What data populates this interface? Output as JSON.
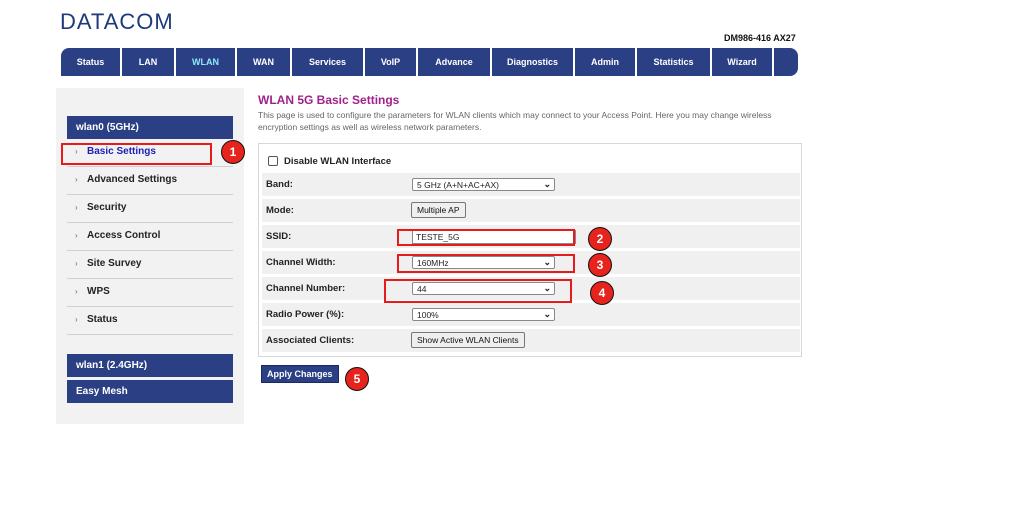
{
  "header": {
    "brand": "DATACOM",
    "model": "DM986-416 AX27"
  },
  "nav": [
    {
      "label": "Status"
    },
    {
      "label": "LAN"
    },
    {
      "label": "WLAN",
      "active": true
    },
    {
      "label": "WAN"
    },
    {
      "label": "Services"
    },
    {
      "label": "VoIP"
    },
    {
      "label": "Advance"
    },
    {
      "label": "Diagnostics"
    },
    {
      "label": "Admin"
    },
    {
      "label": "Statistics"
    },
    {
      "label": "Wizard"
    }
  ],
  "sidebar": {
    "group1": "wlan0 (5GHz)",
    "items": [
      "Basic Settings",
      "Advanced Settings",
      "Security",
      "Access Control",
      "Site Survey",
      "WPS",
      "Status"
    ],
    "group2": "wlan1 (2.4GHz)",
    "group3": "Easy Mesh"
  },
  "page": {
    "title": "WLAN 5G Basic Settings",
    "description": "This page is used to configure the parameters for WLAN clients which may connect to your Access Point. Here you may change wireless encryption settings as well as wireless network parameters."
  },
  "form": {
    "disable_label": "Disable WLAN Interface",
    "band_label": "Band:",
    "band_value": "5 GHz (A+N+AC+AX)",
    "mode_label": "Mode:",
    "mode_button": "Multiple AP",
    "ssid_label": "SSID:",
    "ssid_value": "TESTE_5G",
    "width_label": "Channel Width:",
    "width_value": "160MHz",
    "channel_label": "Channel Number:",
    "channel_value": "44",
    "power_label": "Radio Power (%):",
    "power_value": "100%",
    "clients_label": "Associated Clients:",
    "clients_button": "Show Active WLAN Clients"
  },
  "apply_label": "Apply Changes",
  "annotations": [
    "1",
    "2",
    "3",
    "4",
    "5"
  ],
  "colors": {
    "nav_bg": "#2a3f84",
    "title": "#a0218d",
    "annotation_red": "#e6231d"
  }
}
